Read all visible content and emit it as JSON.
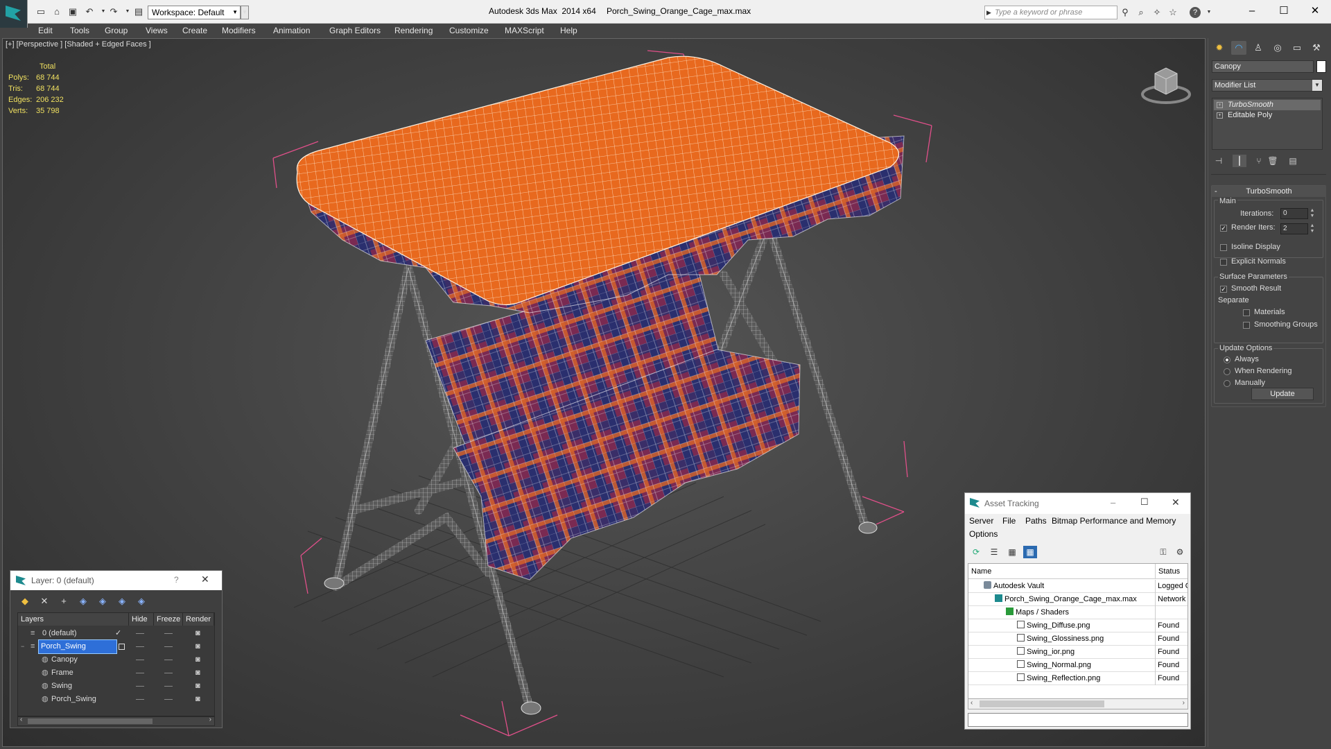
{
  "titlebar": {
    "workspace": "Workspace: Default",
    "app_title": "Autodesk 3ds Max  2014 x64",
    "file_title": "Porch_Swing_Orange_Cage_max.max",
    "search_placeholder": "Type a keyword or phrase"
  },
  "menu": [
    "Edit",
    "Tools",
    "Group",
    "Views",
    "Create",
    "Modifiers",
    "Animation",
    "Graph Editors",
    "Rendering",
    "Customize",
    "MAXScript",
    "Help"
  ],
  "viewport": {
    "label": "[+] [Perspective ] [Shaded + Edged Faces ]",
    "stats": {
      "header": "Total",
      "rows": [
        {
          "label": "Polys:",
          "value": "68 744"
        },
        {
          "label": "Tris:",
          "value": "68 744"
        },
        {
          "label": "Edges:",
          "value": "206 232"
        },
        {
          "label": "Verts:",
          "value": "35 798"
        }
      ]
    }
  },
  "command_panel": {
    "object_name": "Canopy",
    "modifier_list": "Modifier List",
    "stack": [
      "TurboSmooth",
      "Editable Poly"
    ],
    "rollout_title": "TurboSmooth",
    "main_label": "Main",
    "iterations_label": "Iterations:",
    "iterations_value": "0",
    "render_iters_label": "Render Iters:",
    "render_iters_value": "2",
    "isoline_label": "Isoline Display",
    "explicit_normals_label": "Explicit Normals",
    "surface_params_label": "Surface Parameters",
    "smooth_result_label": "Smooth Result",
    "separate_label": "Separate",
    "materials_label": "Materials",
    "smoothing_groups_label": "Smoothing Groups",
    "update_options_label": "Update Options",
    "always_label": "Always",
    "when_rendering_label": "When Rendering",
    "manually_label": "Manually",
    "update_button": "Update"
  },
  "asset_tracking": {
    "title": "Asset Tracking",
    "menu": [
      "Server",
      "File",
      "Paths",
      "Bitmap Performance and Memory",
      "Options"
    ],
    "columns": [
      "Name",
      "Status"
    ],
    "rows": [
      {
        "name": "Autodesk Vault",
        "status": "Logged Out"
      },
      {
        "name": "Porch_Swing_Orange_Cage_max.max",
        "status": "Network"
      },
      {
        "name": "Maps / Shaders",
        "status": ""
      },
      {
        "name": "Swing_Diffuse.png",
        "status": "Found"
      },
      {
        "name": "Swing_Glossiness.png",
        "status": "Found"
      },
      {
        "name": "Swing_ior.png",
        "status": "Found"
      },
      {
        "name": "Swing_Normal.png",
        "status": "Found"
      },
      {
        "name": "Swing_Reflection.png",
        "status": "Found"
      }
    ]
  },
  "layer_dialog": {
    "title": "Layer: 0 (default)",
    "help": "?",
    "columns": [
      "Layers",
      "Hide",
      "Freeze",
      "Render"
    ],
    "rows": [
      {
        "name": "0 (default)"
      },
      {
        "name": "Porch_Swing"
      },
      {
        "name": "Canopy"
      },
      {
        "name": "Frame"
      },
      {
        "name": "Swing"
      },
      {
        "name": "Porch_Swing"
      }
    ]
  },
  "colors": {
    "canopy": "#e8691e",
    "bbox": "#e0508a",
    "stats": "#f0e060",
    "selection": "#2e6fd8"
  }
}
